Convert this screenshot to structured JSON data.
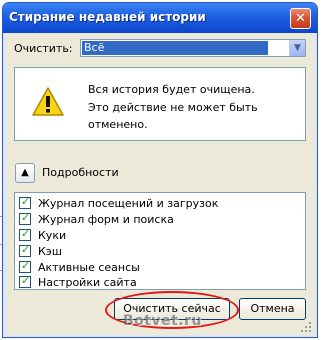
{
  "window": {
    "title": "Стирание недавней истории",
    "close_glyph": "✕"
  },
  "range": {
    "label": "Очистить:",
    "selected": "Всё",
    "arrow_glyph": "▼"
  },
  "warning": {
    "icon": "warning-icon",
    "line1": "Вся история будет очищена.",
    "line2": "Это действие не может быть",
    "line3": "отменено."
  },
  "details": {
    "toggle_glyph": "▲",
    "label": "Подробности"
  },
  "items": [
    {
      "label": "Журнал посещений и загрузок",
      "checked": true
    },
    {
      "label": "Журнал форм и поиска",
      "checked": true
    },
    {
      "label": "Куки",
      "checked": true
    },
    {
      "label": "Кэш",
      "checked": true
    },
    {
      "label": "Активные сеансы",
      "checked": true
    },
    {
      "label": "Настройки сайта",
      "checked": true
    }
  ],
  "buttons": {
    "clear_now": "Очистить сейчас",
    "cancel": "Отмена"
  },
  "watermark": "Botvet.ru",
  "colors": {
    "title_bar": "#1f5fe0",
    "dialog_bg": "#ece9d8",
    "highlight": "#316ac5",
    "annotation_circle": "#e01818"
  }
}
